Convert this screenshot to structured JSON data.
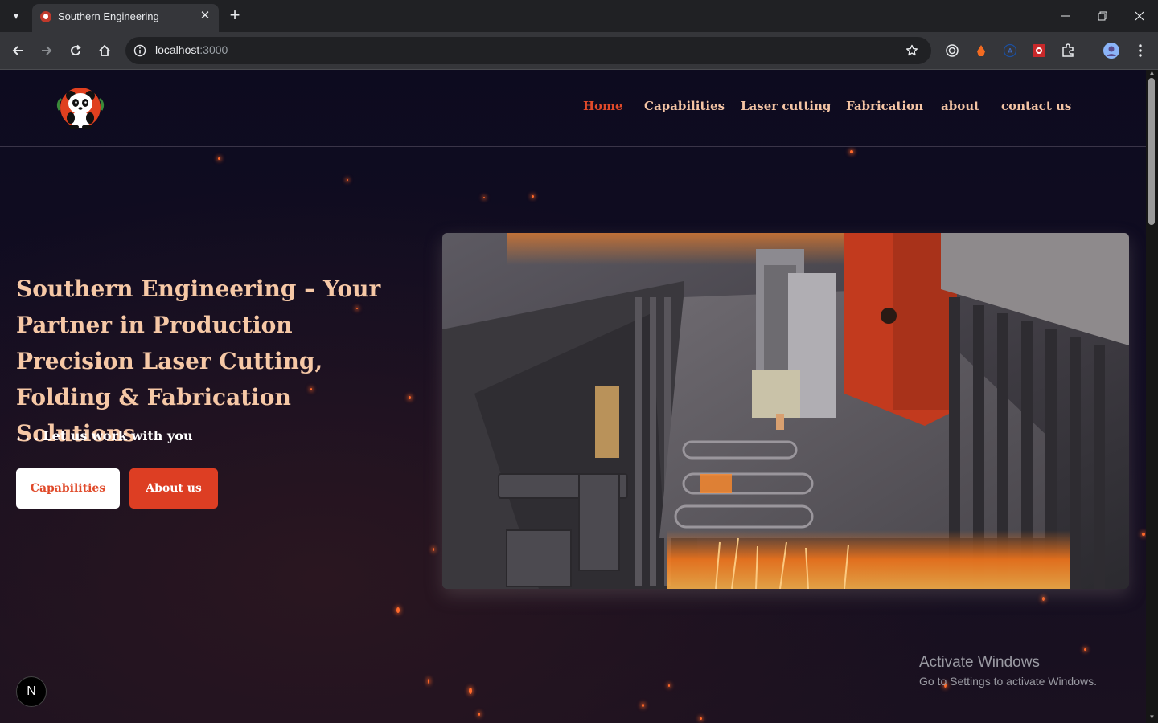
{
  "browser": {
    "tab_title": "Southern Engineering",
    "url_host": "localhost",
    "url_port": ":3000"
  },
  "site": {
    "nav": [
      "Home",
      "Capabilities",
      "Laser cutting",
      "Fabrication",
      "about",
      "contact us"
    ],
    "active_nav": "Home"
  },
  "hero": {
    "title": "Southern Engineering – Your Partner in Production Precision Laser Cutting, Folding & Fabrication Solutions",
    "subtitle": ". . . Let us work with you",
    "buttons": {
      "capabilities": "Capabilities",
      "about": "About us"
    }
  },
  "next_badge": "N",
  "watermark": {
    "line1": "Activate Windows",
    "line2": "Go to Settings to activate Windows."
  },
  "colors": {
    "accent": "#dd3e23",
    "heading": "#f6c8a6",
    "nav": "#f4c4a4",
    "background": "#0d0b1f"
  }
}
